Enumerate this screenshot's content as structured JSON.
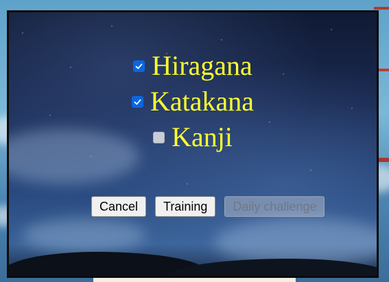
{
  "options": [
    {
      "label": "Hiragana",
      "checked": true
    },
    {
      "label": "Katakana",
      "checked": true
    },
    {
      "label": "Kanji",
      "checked": false
    }
  ],
  "buttons": {
    "cancel": "Cancel",
    "training": "Training",
    "daily_challenge": "Daily challenge"
  },
  "colors": {
    "label_color": "#ffff2e",
    "checkbox_accent": "#0b66e0"
  }
}
